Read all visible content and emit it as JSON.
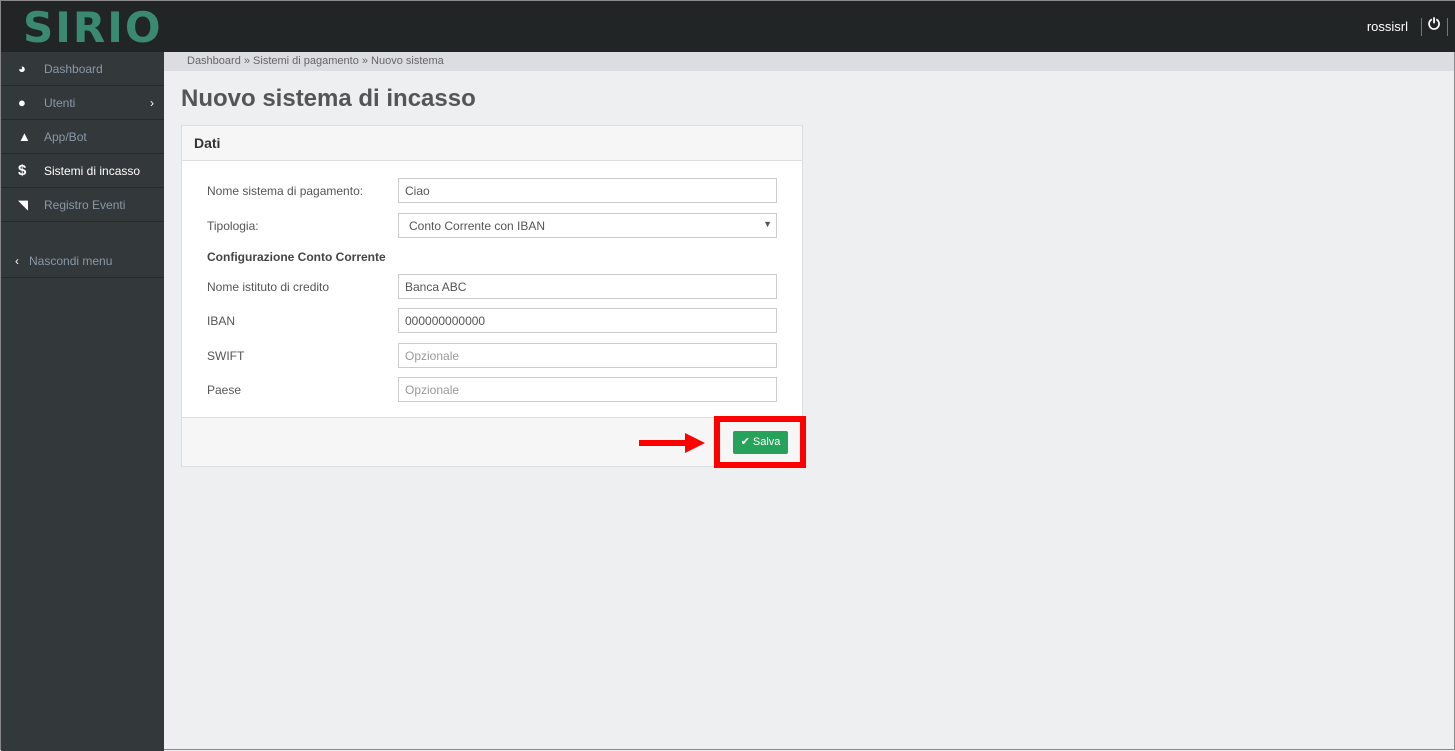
{
  "header": {
    "logo": "SIRIO",
    "user": "rossisrl"
  },
  "sidebar": {
    "items": [
      {
        "label": "Dashboard",
        "icon": "dashboard-icon"
      },
      {
        "label": "Utenti",
        "icon": "user-icon"
      },
      {
        "label": "App/Bot",
        "icon": "android-icon"
      },
      {
        "label": "Sistemi di incasso",
        "icon": "dollar-icon",
        "active": true
      },
      {
        "label": "Registro Eventi",
        "icon": "rss-icon"
      }
    ],
    "hide": "Nascondi menu"
  },
  "breadcrumb": "Dashboard » Sistemi di pagamento » Nuovo sistema",
  "title": "Nuovo sistema di incasso",
  "panel": {
    "title": "Dati",
    "name_label": "Nome sistema di pagamento:",
    "name_value": "Ciao",
    "type_label": "Tipologia:",
    "type_value": "Conto Corrente con IBAN",
    "section": "Configurazione Conto Corrente",
    "bank_label": "Nome istituto di credito",
    "bank_value": "Banca ABC",
    "iban_label": "IBAN",
    "iban_value": "000000000000",
    "swift_label": "SWIFT",
    "swift_placeholder": "Opzionale",
    "country_label": "Paese",
    "country_placeholder": "Opzionale",
    "save": "Salva"
  },
  "colors": {
    "accent": "#27a25a",
    "highlight": "#ff0000"
  }
}
